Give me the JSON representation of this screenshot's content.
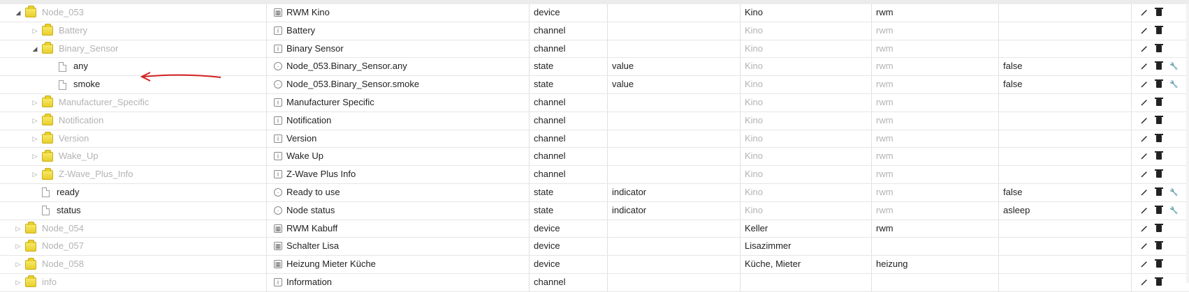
{
  "rows": [
    {
      "tree": "Node_053",
      "indent": 0,
      "kind": "folder",
      "expand": "open",
      "name": "RWM Kino",
      "name_icon": "device",
      "type": "device",
      "role": "",
      "room": "Kino",
      "room_dark": true,
      "func": "rwm",
      "func_dark": true,
      "value": "",
      "wrench": false
    },
    {
      "tree": "Battery",
      "indent": 1,
      "kind": "folder",
      "expand": "collapsed",
      "name": "Battery",
      "name_icon": "channel",
      "type": "channel",
      "role": "",
      "room": "Kino",
      "room_dark": false,
      "func": "rwm",
      "func_dark": false,
      "value": "",
      "wrench": false
    },
    {
      "tree": "Binary_Sensor",
      "indent": 1,
      "kind": "folder",
      "expand": "open",
      "name": "Binary Sensor",
      "name_icon": "channel",
      "type": "channel",
      "role": "",
      "room": "Kino",
      "room_dark": false,
      "func": "rwm",
      "func_dark": false,
      "value": "",
      "wrench": false
    },
    {
      "tree": "any",
      "indent": 2,
      "kind": "file",
      "expand": "none",
      "name": "Node_053.Binary_Sensor.any",
      "name_icon": "state",
      "type": "state",
      "role": "value",
      "room": "Kino",
      "room_dark": false,
      "func": "rwm",
      "func_dark": false,
      "value": "false",
      "wrench": true
    },
    {
      "tree": "smoke",
      "indent": 2,
      "kind": "file",
      "expand": "none",
      "name": "Node_053.Binary_Sensor.smoke",
      "name_icon": "state",
      "type": "state",
      "role": "value",
      "room": "Kino",
      "room_dark": false,
      "func": "rwm",
      "func_dark": false,
      "value": "false",
      "wrench": true
    },
    {
      "tree": "Manufacturer_Specific",
      "indent": 1,
      "kind": "folder",
      "expand": "collapsed",
      "name": "Manufacturer Specific",
      "name_icon": "channel",
      "type": "channel",
      "role": "",
      "room": "Kino",
      "room_dark": false,
      "func": "rwm",
      "func_dark": false,
      "value": "",
      "wrench": false
    },
    {
      "tree": "Notification",
      "indent": 1,
      "kind": "folder",
      "expand": "collapsed",
      "name": "Notification",
      "name_icon": "channel",
      "type": "channel",
      "role": "",
      "room": "Kino",
      "room_dark": false,
      "func": "rwm",
      "func_dark": false,
      "value": "",
      "wrench": false
    },
    {
      "tree": "Version",
      "indent": 1,
      "kind": "folder",
      "expand": "collapsed",
      "name": "Version",
      "name_icon": "channel",
      "type": "channel",
      "role": "",
      "room": "Kino",
      "room_dark": false,
      "func": "rwm",
      "func_dark": false,
      "value": "",
      "wrench": false
    },
    {
      "tree": "Wake_Up",
      "indent": 1,
      "kind": "folder",
      "expand": "collapsed",
      "name": "Wake Up",
      "name_icon": "channel",
      "type": "channel",
      "role": "",
      "room": "Kino",
      "room_dark": false,
      "func": "rwm",
      "func_dark": false,
      "value": "",
      "wrench": false
    },
    {
      "tree": "Z-Wave_Plus_Info",
      "indent": 1,
      "kind": "folder",
      "expand": "collapsed",
      "name": "Z-Wave Plus Info",
      "name_icon": "channel",
      "type": "channel",
      "role": "",
      "room": "Kino",
      "room_dark": false,
      "func": "rwm",
      "func_dark": false,
      "value": "",
      "wrench": false
    },
    {
      "tree": "ready",
      "indent": 1,
      "kind": "file",
      "expand": "none",
      "name": "Ready to use",
      "name_icon": "state",
      "type": "state",
      "role": "indicator",
      "room": "Kino",
      "room_dark": false,
      "func": "rwm",
      "func_dark": false,
      "value": "false",
      "wrench": true
    },
    {
      "tree": "status",
      "indent": 1,
      "kind": "file",
      "expand": "none",
      "name": "Node status",
      "name_icon": "state",
      "type": "state",
      "role": "indicator",
      "room": "Kino",
      "room_dark": false,
      "func": "rwm",
      "func_dark": false,
      "value": "asleep",
      "wrench": true
    },
    {
      "tree": "Node_054",
      "indent": 0,
      "kind": "folder",
      "expand": "collapsed",
      "name": "RWM Kabuff",
      "name_icon": "device",
      "type": "device",
      "role": "",
      "room": "Keller",
      "room_dark": true,
      "func": "rwm",
      "func_dark": true,
      "value": "",
      "wrench": false
    },
    {
      "tree": "Node_057",
      "indent": 0,
      "kind": "folder",
      "expand": "collapsed",
      "name": "Schalter Lisa",
      "name_icon": "device",
      "type": "device",
      "role": "",
      "room": "Lisazimmer",
      "room_dark": true,
      "func": "",
      "func_dark": true,
      "value": "",
      "wrench": false
    },
    {
      "tree": "Node_058",
      "indent": 0,
      "kind": "folder",
      "expand": "collapsed",
      "name": "Heizung Mieter Küche",
      "name_icon": "device",
      "type": "device",
      "role": "",
      "room": "Küche, Mieter",
      "room_dark": true,
      "func": "heizung",
      "func_dark": true,
      "value": "",
      "wrench": false
    },
    {
      "tree": "info",
      "indent": 0,
      "kind": "folder",
      "expand": "collapsed",
      "name": "Information",
      "name_icon": "channel",
      "type": "channel",
      "role": "",
      "room": "",
      "room_dark": true,
      "func": "",
      "func_dark": true,
      "value": "",
      "wrench": false
    }
  ],
  "icons": {
    "edit": "pencil-icon",
    "delete": "trash-icon",
    "settings": "wrench-icon"
  },
  "colors": {
    "muted_text": "#b3b3b3",
    "annotation_arrow": "#d21f1f"
  }
}
